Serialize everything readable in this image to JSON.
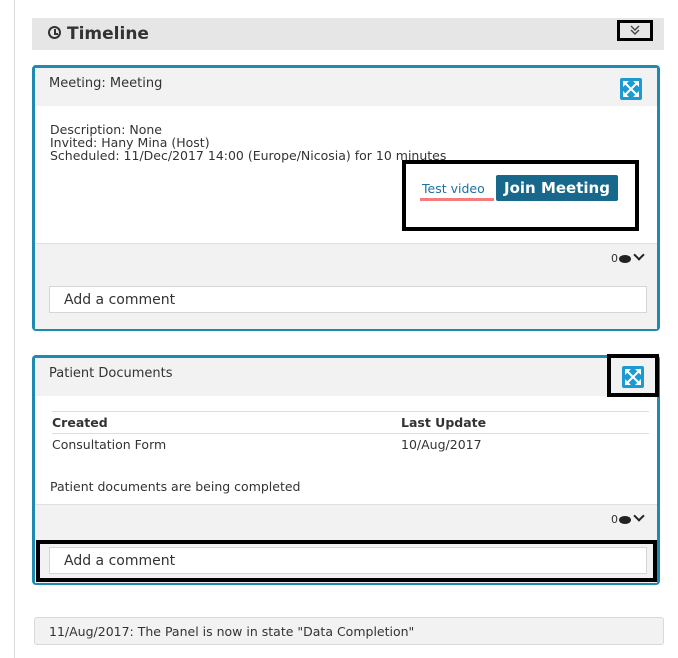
{
  "timeline": {
    "title": "Timeline",
    "clock_icon": "clock-icon",
    "collapse_icon": "double-chevron-down-icon"
  },
  "meeting_card": {
    "title": "Meeting: Meeting",
    "description": "Description: None",
    "invited": "Invited: Hany Mina (Host)",
    "scheduled": "Scheduled: 11/Dec/2017 14:00 (Europe/Nicosia) for 10 minutes",
    "test_video_label": "Test video",
    "join_label": "Join Meeting",
    "comment_count": "0",
    "comment_placeholder": "Add a comment"
  },
  "documents_card": {
    "title": "Patient Documents",
    "columns": [
      "Created",
      "Last Update"
    ],
    "rows": [
      [
        "Consultation Form",
        "10/Aug/2017"
      ]
    ],
    "status_note": "Patient documents are being completed",
    "comment_count": "0",
    "comment_placeholder": "Add a comment"
  },
  "status_entry": {
    "text": "11/Aug/2017: The Panel is now in state \"Data Completion\""
  },
  "colors": {
    "accent": "#1e8ab0",
    "join_button": "#17688a",
    "expand_icon": "#1d9bd1",
    "underline": "#f47c7c"
  }
}
